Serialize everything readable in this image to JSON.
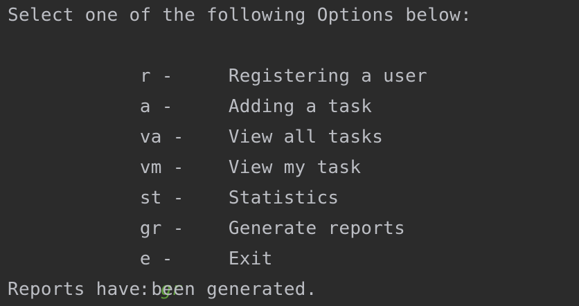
{
  "prompt": {
    "header": "Select one of the following Options below:",
    "options": [
      {
        "key": "r -",
        "label": "Registering a user"
      },
      {
        "key": "a -",
        "label": "Adding a task"
      },
      {
        "key": "va -",
        "label": "View all tasks"
      },
      {
        "key": "vm -",
        "label": "View my task"
      },
      {
        "key": "st -",
        "label": "Statistics"
      },
      {
        "key": "gr -",
        "label": "Generate reports"
      },
      {
        "key": "e -",
        "label": "Exit"
      }
    ],
    "input_prompt": ": ",
    "input_value": "gr"
  },
  "output": {
    "message": "Reports have been generated."
  },
  "colors": {
    "background": "#2b2b2b",
    "text": "#bcbec4",
    "user_input": "#5f9f3a"
  }
}
